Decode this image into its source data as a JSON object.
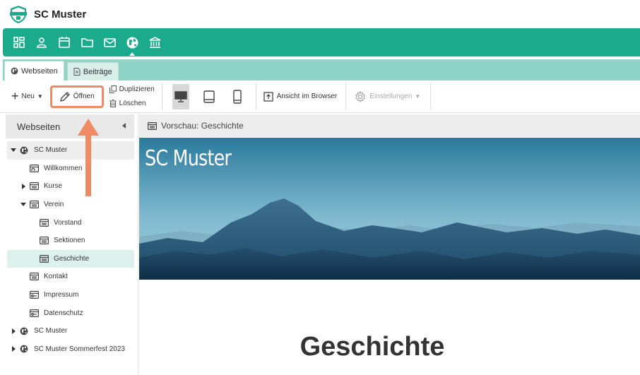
{
  "app": {
    "title": "SC Muster",
    "logo_text": "SC MUSTER"
  },
  "nav": {
    "icons": [
      "dashboard-icon",
      "user-icon",
      "calendar-icon",
      "folder-icon",
      "mail-icon",
      "globe-icon",
      "bank-icon"
    ],
    "active": "globe-icon"
  },
  "tabs": [
    {
      "label": "Webseiten",
      "icon": "globe-icon",
      "active": true
    },
    {
      "label": "Beiträge",
      "icon": "document-icon",
      "active": false
    }
  ],
  "toolbar": {
    "new_label": "Neu",
    "open_label": "Öffnen",
    "duplicate_label": "Duplizieren",
    "delete_label": "Löschen",
    "browser_label": "Ansicht im Browser",
    "settings_label": "Einstellungen"
  },
  "sidebar": {
    "title": "Webseiten",
    "items": [
      {
        "label": "SC Muster",
        "level": 0,
        "expander": "down",
        "icon": "globe-icon"
      },
      {
        "label": "Willkommen",
        "level": 1,
        "expander": "none",
        "icon": "home-page-icon"
      },
      {
        "label": "Kurse",
        "level": 1,
        "expander": "right",
        "icon": "page-icon"
      },
      {
        "label": "Verein",
        "level": 1,
        "expander": "down",
        "icon": "page-icon"
      },
      {
        "label": "Vorstand",
        "level": 2,
        "expander": "none",
        "icon": "page-icon"
      },
      {
        "label": "Sektionen",
        "level": 2,
        "expander": "none",
        "icon": "page-icon"
      },
      {
        "label": "Geschichte",
        "level": 2,
        "expander": "none",
        "icon": "page-icon",
        "selected": true
      },
      {
        "label": "Kontakt",
        "level": 1,
        "expander": "none",
        "icon": "page-icon"
      },
      {
        "label": "Impressum",
        "level": 1,
        "expander": "none",
        "icon": "link-page-icon"
      },
      {
        "label": "Datenschutz",
        "level": 1,
        "expander": "none",
        "icon": "link-page-icon"
      },
      {
        "label": "SC Muster",
        "level": 0,
        "expander": "right",
        "icon": "globe-icon"
      },
      {
        "label": "SC Muster Sommerfest 2023",
        "level": 0,
        "expander": "right",
        "icon": "globe-icon"
      }
    ]
  },
  "preview": {
    "header": "Vorschau: Geschichte",
    "hero_title": "SC Muster",
    "page_heading": "Geschichte"
  },
  "colors": {
    "brand": "#1bab8c",
    "tabstrip": "#8fd4c4",
    "highlight": "#f08a64",
    "selected_row": "#dcf1eb"
  }
}
